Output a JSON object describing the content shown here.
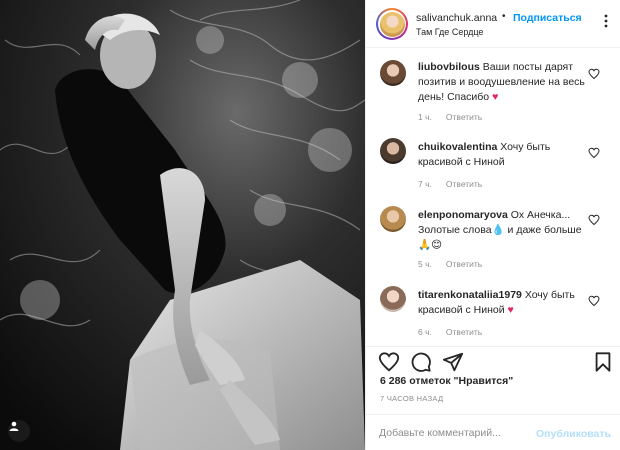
{
  "post": {
    "author": "salivanchuk.anna",
    "separator": "•",
    "follow_label": "Подписаться",
    "location": "Там Где Сердце"
  },
  "comments": [
    {
      "user": "liubovbilous",
      "text": "Ваши посты дарят позитив и воодушевление на весь день! Спасибо",
      "emoji": "♥",
      "time": "1 ч.",
      "reply_label": "Ответить"
    },
    {
      "user": "chuikovalentina",
      "text": "Хочу быть красивой с Ниной",
      "emoji": "",
      "time": "7 ч.",
      "reply_label": "Ответить"
    },
    {
      "user": "elenponomaryova",
      "text": "Ох Анечка... Золотые слова💧 и даже больше🙏😊",
      "emoji": "",
      "time": "5 ч.",
      "reply_label": "Ответить"
    },
    {
      "user": "titarenkonataliia1979",
      "text": "Хочу быть красивой с Ниной",
      "emoji": "♥",
      "time": "6 ч.",
      "reply_label": "Ответить"
    }
  ],
  "stats": {
    "likes_text": "6 286 отметок \"Нравится\"",
    "time_ago": "7 ЧАСОВ НАЗАД"
  },
  "composer": {
    "placeholder": "Добавьте комментарий...",
    "publish_label": "Опубликовать"
  },
  "icons": {
    "like": "heart-outline-icon",
    "comment": "speech-bubble-icon",
    "share": "paper-plane-icon",
    "save": "bookmark-icon",
    "more": "more-dots-icon",
    "tag": "user-tag-icon"
  },
  "colors": {
    "link": "#0095f6",
    "publish_disabled": "#b2dffc",
    "meta": "#8e8e8e",
    "heart": "#e0245e"
  }
}
